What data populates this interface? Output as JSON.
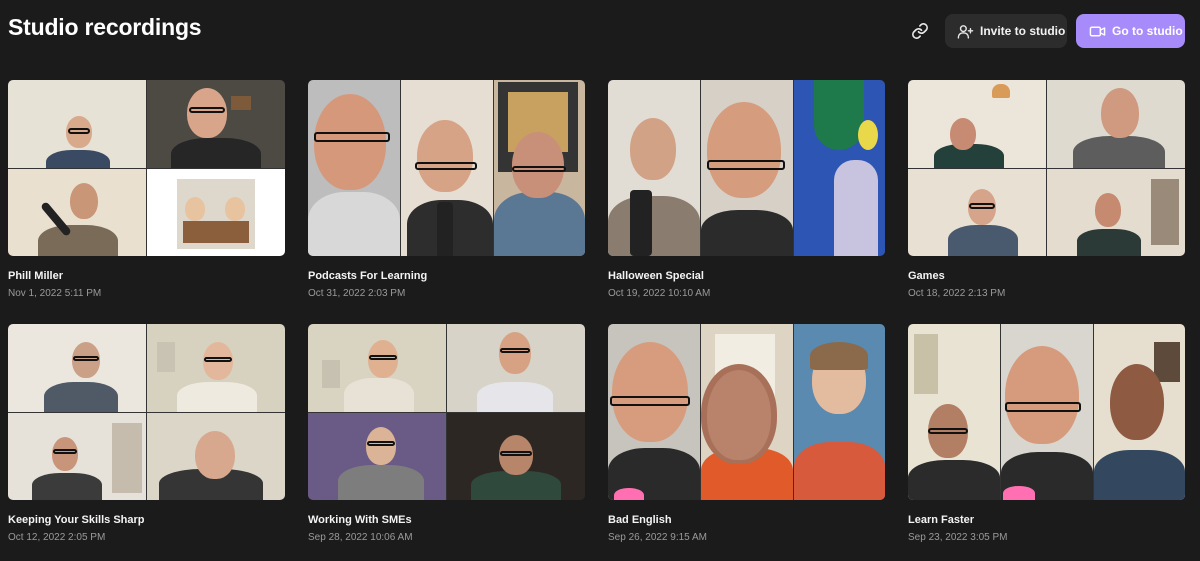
{
  "header": {
    "title": "Studio recordings",
    "link_icon": "link-icon",
    "invite_label": "Invite to studio",
    "invite_icon": "user-plus-icon",
    "studio_label": "Go to studio",
    "studio_icon": "video-camera-icon"
  },
  "colors": {
    "background": "#1b1b1b",
    "accent": "#a78bfa",
    "secondary_button": "#2c2c2c",
    "muted_text": "#9a9a9a"
  },
  "recordings": [
    {
      "name": "Phill Miller",
      "date": "Nov 1, 2022 5:11 PM"
    },
    {
      "name": "Podcasts For Learning",
      "date": "Oct 31, 2022 2:03 PM"
    },
    {
      "name": "Halloween Special",
      "date": "Oct 19, 2022 10:10 AM"
    },
    {
      "name": "Games",
      "date": "Oct 18, 2022 2:13 PM"
    },
    {
      "name": "Keeping Your Skills Sharp",
      "date": "Oct 12, 2022 2:05 PM"
    },
    {
      "name": "Working With SMEs",
      "date": "Sep 28, 2022 10:06 AM"
    },
    {
      "name": "Bad English",
      "date": "Sep 26, 2022 9:15 AM"
    },
    {
      "name": "Learn Faster",
      "date": "Sep 23, 2022 3:05 PM"
    }
  ]
}
